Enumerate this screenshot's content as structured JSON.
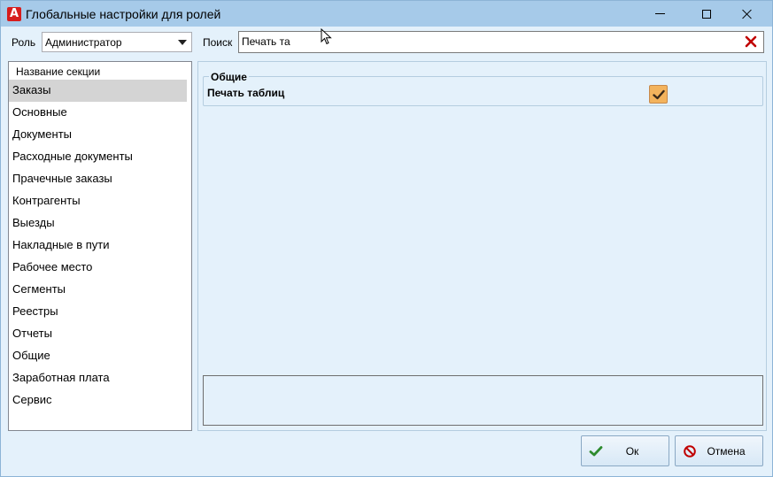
{
  "window": {
    "title": "Глобальные настройки для ролей",
    "app_icon_letter": "A"
  },
  "toolbar": {
    "role_label": "Роль",
    "role_value": "Администратор",
    "search_label": "Поиск",
    "search_value": "Печать та"
  },
  "sections": {
    "header": "Название секции",
    "items": [
      "Заказы",
      "Основные",
      "Документы",
      "Расходные документы",
      "Прачечные заказы",
      "Контрагенты",
      "Выезды",
      "Накладные в пути",
      "Рабочее место",
      "Сегменты",
      "Реестры",
      "Отчеты",
      "Общие",
      "Заработная плата",
      "Сервис"
    ],
    "selected_index": 0
  },
  "settings": {
    "group_title": "Общие",
    "option_label": "Печать таблиц",
    "option_checked": true
  },
  "buttons": {
    "ok_label": "Ок",
    "cancel_label": "Отмена"
  },
  "colors": {
    "window_bg": "#e4f1fb",
    "titlebar_bg": "#a6cae9",
    "checkbox_fill": "#f3b35c",
    "clear_icon": "#c00000",
    "ok_icon": "#2e8b2e",
    "cancel_icon": "#c00000"
  },
  "icons": {
    "clear": "close-x-icon",
    "ok": "check-icon",
    "cancel": "no-entry-icon"
  }
}
